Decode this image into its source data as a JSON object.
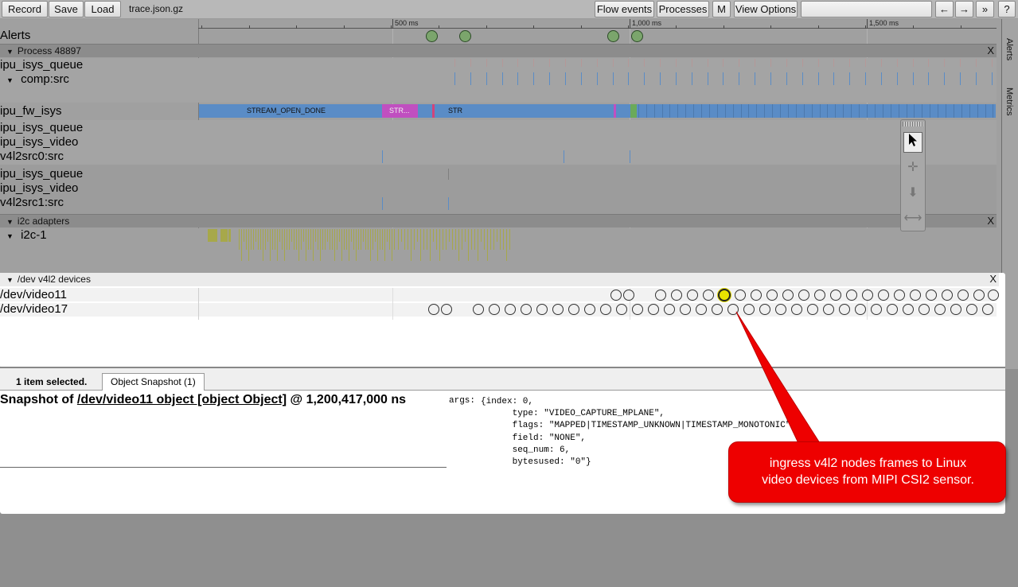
{
  "toolbar": {
    "record": "Record",
    "save": "Save",
    "load": "Load",
    "filename": "trace.json.gz",
    "flow_events": "Flow events",
    "processes": "Processes",
    "m": "M",
    "view_options": "View Options",
    "search_value": "",
    "prev": "←",
    "next": "→",
    "expand": "»",
    "help": "?"
  },
  "ruler": {
    "ticks": [
      "500 ms",
      "1,000 ms",
      "1,500 ms"
    ]
  },
  "tracks": {
    "alerts": "Alerts",
    "process_group": "Process 48897",
    "ipu_isys_queue_1": "ipu_isys_queue",
    "comp_src": "comp:src",
    "ipu_fw_isys": "ipu_fw_isys",
    "ipu_isys_queue_2": "ipu_isys_queue",
    "ipu_isys_video_1": "ipu_isys_video",
    "v4l2src0": "v4l2src0:src",
    "ipu_isys_queue_3": "ipu_isys_queue",
    "ipu_isys_video_2": "ipu_isys_video",
    "v4l2src1": "v4l2src1:src",
    "i2c_group": "i2c adapters",
    "i2c_1": "i2c-1",
    "close": "X"
  },
  "slices": {
    "stream_open_done": "STREAM_OPEN_DONE",
    "str_short": "STR...",
    "str": "STR"
  },
  "devices": {
    "group": "/dev v4l2 devices",
    "video11": "/dev/video11",
    "video17": "/dev/video17",
    "close": "X"
  },
  "side_tabs": {
    "alerts": "Alerts",
    "metrics": "Metrics"
  },
  "bottom": {
    "selected": "1 item selected.",
    "tab": "Object Snapshot (1)",
    "snap_prefix": "Snapshot of ",
    "snap_link": "/dev/video11 object [object Object]",
    "snap_suffix": " @ 1,200,417,000 ns",
    "args_key": "args:",
    "args_value": "{index: 0,\n      type: \"VIDEO_CAPTURE_MPLANE\",\n      flags: \"MAPPED|TIMESTAMP_UNKNOWN|TIMESTAMP_MONOTONIC\",\n      field: \"NONE\",\n      seq_num: 6,\n      bytesused: \"0\"}"
  },
  "callout": {
    "line1": "ingress v4l2 nodes frames to Linux",
    "line2": "video devices from MIPI CSI2 sensor."
  },
  "colors": {
    "slice_blue": "#5a8cc6",
    "slice_magenta": "#c04fc0",
    "slice_green": "#6aaa5a",
    "i2c_olive": "#a7a84a",
    "alert_green": "#7ba56c",
    "callout_red": "#ee0000",
    "selected_yellow": "#e8e200"
  }
}
